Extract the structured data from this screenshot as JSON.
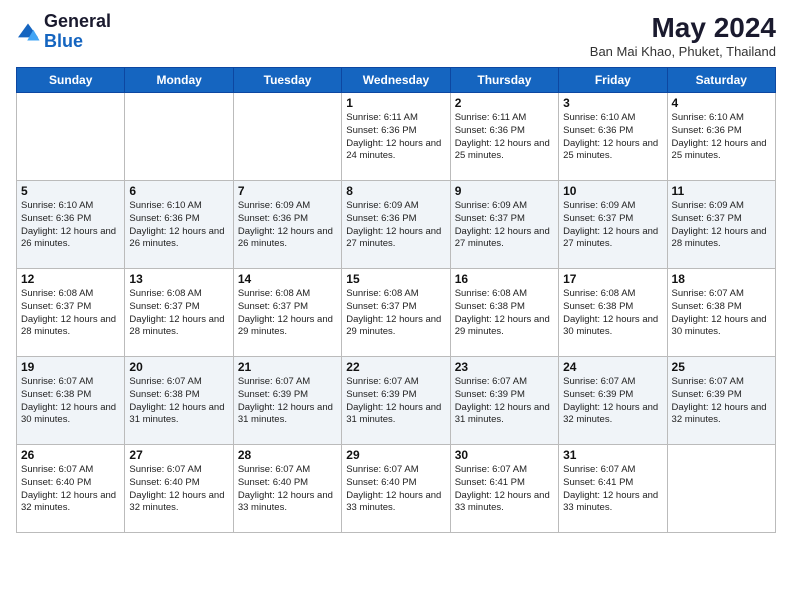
{
  "header": {
    "logo_general": "General",
    "logo_blue": "Blue",
    "month_year": "May 2024",
    "location": "Ban Mai Khao, Phuket, Thailand"
  },
  "weekdays": [
    "Sunday",
    "Monday",
    "Tuesday",
    "Wednesday",
    "Thursday",
    "Friday",
    "Saturday"
  ],
  "weeks": [
    [
      {
        "day": "",
        "info": ""
      },
      {
        "day": "",
        "info": ""
      },
      {
        "day": "",
        "info": ""
      },
      {
        "day": "1",
        "info": "Sunrise: 6:11 AM\nSunset: 6:36 PM\nDaylight: 12 hours and 24 minutes."
      },
      {
        "day": "2",
        "info": "Sunrise: 6:11 AM\nSunset: 6:36 PM\nDaylight: 12 hours and 25 minutes."
      },
      {
        "day": "3",
        "info": "Sunrise: 6:10 AM\nSunset: 6:36 PM\nDaylight: 12 hours and 25 minutes."
      },
      {
        "day": "4",
        "info": "Sunrise: 6:10 AM\nSunset: 6:36 PM\nDaylight: 12 hours and 25 minutes."
      }
    ],
    [
      {
        "day": "5",
        "info": "Sunrise: 6:10 AM\nSunset: 6:36 PM\nDaylight: 12 hours and 26 minutes."
      },
      {
        "day": "6",
        "info": "Sunrise: 6:10 AM\nSunset: 6:36 PM\nDaylight: 12 hours and 26 minutes."
      },
      {
        "day": "7",
        "info": "Sunrise: 6:09 AM\nSunset: 6:36 PM\nDaylight: 12 hours and 26 minutes."
      },
      {
        "day": "8",
        "info": "Sunrise: 6:09 AM\nSunset: 6:36 PM\nDaylight: 12 hours and 27 minutes."
      },
      {
        "day": "9",
        "info": "Sunrise: 6:09 AM\nSunset: 6:37 PM\nDaylight: 12 hours and 27 minutes."
      },
      {
        "day": "10",
        "info": "Sunrise: 6:09 AM\nSunset: 6:37 PM\nDaylight: 12 hours and 27 minutes."
      },
      {
        "day": "11",
        "info": "Sunrise: 6:09 AM\nSunset: 6:37 PM\nDaylight: 12 hours and 28 minutes."
      }
    ],
    [
      {
        "day": "12",
        "info": "Sunrise: 6:08 AM\nSunset: 6:37 PM\nDaylight: 12 hours and 28 minutes."
      },
      {
        "day": "13",
        "info": "Sunrise: 6:08 AM\nSunset: 6:37 PM\nDaylight: 12 hours and 28 minutes."
      },
      {
        "day": "14",
        "info": "Sunrise: 6:08 AM\nSunset: 6:37 PM\nDaylight: 12 hours and 29 minutes."
      },
      {
        "day": "15",
        "info": "Sunrise: 6:08 AM\nSunset: 6:37 PM\nDaylight: 12 hours and 29 minutes."
      },
      {
        "day": "16",
        "info": "Sunrise: 6:08 AM\nSunset: 6:38 PM\nDaylight: 12 hours and 29 minutes."
      },
      {
        "day": "17",
        "info": "Sunrise: 6:08 AM\nSunset: 6:38 PM\nDaylight: 12 hours and 30 minutes."
      },
      {
        "day": "18",
        "info": "Sunrise: 6:07 AM\nSunset: 6:38 PM\nDaylight: 12 hours and 30 minutes."
      }
    ],
    [
      {
        "day": "19",
        "info": "Sunrise: 6:07 AM\nSunset: 6:38 PM\nDaylight: 12 hours and 30 minutes."
      },
      {
        "day": "20",
        "info": "Sunrise: 6:07 AM\nSunset: 6:38 PM\nDaylight: 12 hours and 31 minutes."
      },
      {
        "day": "21",
        "info": "Sunrise: 6:07 AM\nSunset: 6:39 PM\nDaylight: 12 hours and 31 minutes."
      },
      {
        "day": "22",
        "info": "Sunrise: 6:07 AM\nSunset: 6:39 PM\nDaylight: 12 hours and 31 minutes."
      },
      {
        "day": "23",
        "info": "Sunrise: 6:07 AM\nSunset: 6:39 PM\nDaylight: 12 hours and 31 minutes."
      },
      {
        "day": "24",
        "info": "Sunrise: 6:07 AM\nSunset: 6:39 PM\nDaylight: 12 hours and 32 minutes."
      },
      {
        "day": "25",
        "info": "Sunrise: 6:07 AM\nSunset: 6:39 PM\nDaylight: 12 hours and 32 minutes."
      }
    ],
    [
      {
        "day": "26",
        "info": "Sunrise: 6:07 AM\nSunset: 6:40 PM\nDaylight: 12 hours and 32 minutes."
      },
      {
        "day": "27",
        "info": "Sunrise: 6:07 AM\nSunset: 6:40 PM\nDaylight: 12 hours and 32 minutes."
      },
      {
        "day": "28",
        "info": "Sunrise: 6:07 AM\nSunset: 6:40 PM\nDaylight: 12 hours and 33 minutes."
      },
      {
        "day": "29",
        "info": "Sunrise: 6:07 AM\nSunset: 6:40 PM\nDaylight: 12 hours and 33 minutes."
      },
      {
        "day": "30",
        "info": "Sunrise: 6:07 AM\nSunset: 6:41 PM\nDaylight: 12 hours and 33 minutes."
      },
      {
        "day": "31",
        "info": "Sunrise: 6:07 AM\nSunset: 6:41 PM\nDaylight: 12 hours and 33 minutes."
      },
      {
        "day": "",
        "info": ""
      }
    ]
  ]
}
